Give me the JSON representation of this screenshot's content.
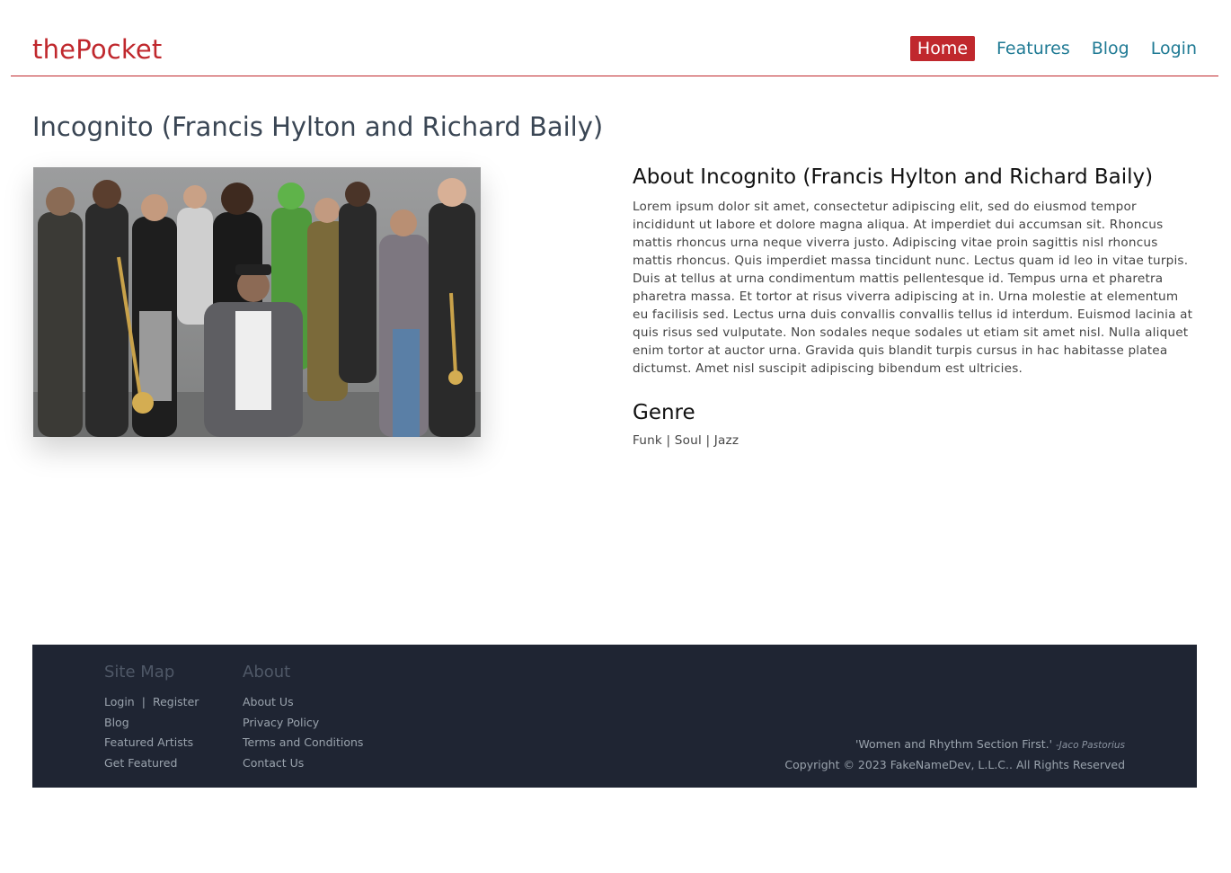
{
  "header": {
    "brand": "thePocket",
    "nav": {
      "home": "Home",
      "features": "Features",
      "blog": "Blog",
      "login": "Login"
    }
  },
  "page": {
    "title": "Incognito (Francis Hylton and Richard Baily)"
  },
  "about": {
    "heading": "About Incognito (Francis Hylton and Richard Baily)",
    "body": "Lorem ipsum dolor sit amet, consectetur adipiscing elit, sed do eiusmod tempor incididunt ut labore et dolore magna aliqua. At imperdiet dui accumsan sit. Rhoncus mattis rhoncus urna neque viverra justo. Adipiscing vitae proin sagittis nisl rhoncus mattis rhoncus. Quis imperdiet massa tincidunt nunc. Lectus quam id leo in vitae turpis. Duis at tellus at urna condimentum mattis pellentesque id. Tempus urna et pharetra pharetra massa. Et tortor at risus viverra adipiscing at in. Urna molestie at elementum eu facilisis sed. Lectus urna duis convallis convallis tellus id interdum. Euismod lacinia at quis risus sed vulputate. Non sodales neque sodales ut etiam sit amet nisl. Nulla aliquet enim tortor at auctor urna. Gravida quis blandit turpis cursus in hac habitasse platea dictumst. Amet nisl suscipit adipiscing bibendum est ultricies.",
    "genre_heading": "Genre",
    "genres": "Funk | Soul | Jazz"
  },
  "footer": {
    "sitemap": {
      "heading": "Site Map",
      "login": "Login",
      "separator": "|",
      "register": "Register",
      "blog": "Blog",
      "featured_artists": "Featured Artists",
      "get_featured": "Get Featured"
    },
    "about": {
      "heading": "About",
      "about_us": "About Us",
      "privacy": "Privacy Policy",
      "terms": "Terms and Conditions",
      "contact": "Contact Us"
    },
    "quote": "'Women and Rhythm Section First.'",
    "quote_author": "-Jaco Pastorius",
    "copyright": "Copyright © 2023 FakeNameDev, L.L.C.. All Rights Reserved"
  },
  "colors": {
    "brand": "#c0282d",
    "nav_link": "#1f7a94",
    "footer_bg": "#1f2533"
  }
}
